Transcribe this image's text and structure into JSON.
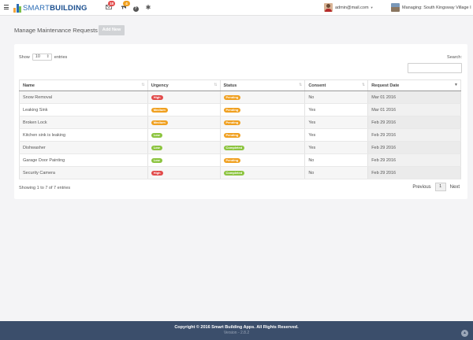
{
  "brand": {
    "light": "SMART",
    "bold": "BUILDING"
  },
  "nav": {
    "mail_count": "18",
    "alerts_count": "4",
    "help_glyph": "?",
    "settings_glyph": "✱"
  },
  "user": {
    "email": "admin@mail.com"
  },
  "managing": "Managing: South Kingsway Village I",
  "page": {
    "title": "Manage Maintenance Requests",
    "add_label": "Add New"
  },
  "table_controls": {
    "show_label": "Show",
    "entries_label": "entries",
    "page_length": "10",
    "search_label": "Search:"
  },
  "table": {
    "columns": [
      "Name",
      "Urgency",
      "Status",
      "Consent",
      "Request Date"
    ],
    "rows": [
      {
        "name": "Snow Removal",
        "urgency": "High",
        "status": "Pending",
        "consent": "No",
        "date": "Mar 01 2016"
      },
      {
        "name": "Leaking Sink",
        "urgency": "Medium",
        "status": "Pending",
        "consent": "Yes",
        "date": "Mar 01 2016"
      },
      {
        "name": "Broken Lock",
        "urgency": "Medium",
        "status": "Pending",
        "consent": "Yes",
        "date": "Feb 29 2016"
      },
      {
        "name": "Kitchen sink is leaking",
        "urgency": "Low",
        "status": "Pending",
        "consent": "Yes",
        "date": "Feb 29 2016"
      },
      {
        "name": "Dishwasher",
        "urgency": "Low",
        "status": "Completed",
        "consent": "Yes",
        "date": "Feb 29 2016"
      },
      {
        "name": "Garage Door Painting",
        "urgency": "Low",
        "status": "Pending",
        "consent": "No",
        "date": "Feb 29 2016"
      },
      {
        "name": "Security Camera",
        "urgency": "High",
        "status": "Completed",
        "consent": "No",
        "date": "Feb 29 2016"
      }
    ]
  },
  "pagination": {
    "info": "Showing 1 to 7 of 7 entries",
    "previous": "Previous",
    "current": "1",
    "next": "Next"
  },
  "footer": {
    "copyright": "Copyright © 2016 Smart Building Apps. All Rights Reserved.",
    "version": "Version - 2.8.2"
  },
  "colors": {
    "high": "#e24b4b",
    "medium": "#f0a020",
    "low": "#8cc43f",
    "pending": "#f0a020",
    "completed": "#8cc43f",
    "mail_badge": "#e24b4b",
    "alert_badge": "#f0a020",
    "footer": "#3b4e6b"
  }
}
